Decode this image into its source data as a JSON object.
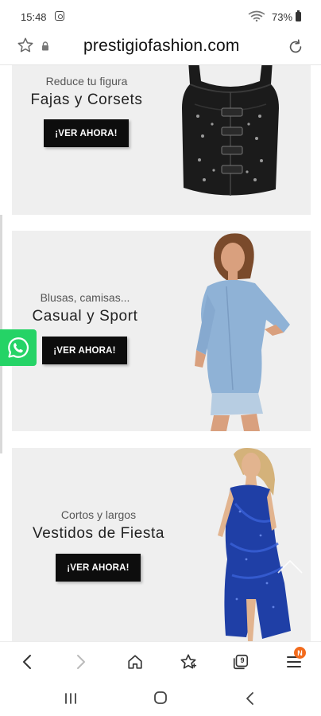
{
  "status_bar": {
    "time": "15:48",
    "battery": "73%"
  },
  "address_bar": {
    "url": "prestigiofashion.com"
  },
  "banners": [
    {
      "subtitle": "Reduce tu figura",
      "title": "Fajas y Corsets",
      "button": "¡VER AHORA!",
      "image": "black-corset-illustration"
    },
    {
      "subtitle": "Blusas, camisas...",
      "title": "Casual y Sport",
      "button": "¡VER AHORA!",
      "image": "denim-shirt-model-illustration"
    },
    {
      "subtitle": "Cortos y largos",
      "title": "Vestidos de Fiesta",
      "button": "¡VER AHORA!",
      "image": "blue-sequin-dress-model-illustration"
    }
  ],
  "toolbar": {
    "tabs_count": "9",
    "notification_badge": "N"
  },
  "icons": {
    "whatsapp": "whatsapp-icon",
    "back": "back-arrow-icon",
    "forward": "forward-arrow-icon",
    "home": "home-icon",
    "bookmarks": "bookmark-star-icon",
    "tabs": "tabs-icon",
    "menu": "menu-icon"
  },
  "colors": {
    "whatsapp_green": "#25d366",
    "button_black": "#0d0d0d",
    "badge_orange": "#f26b1d",
    "banner_bg": "#efefef"
  }
}
